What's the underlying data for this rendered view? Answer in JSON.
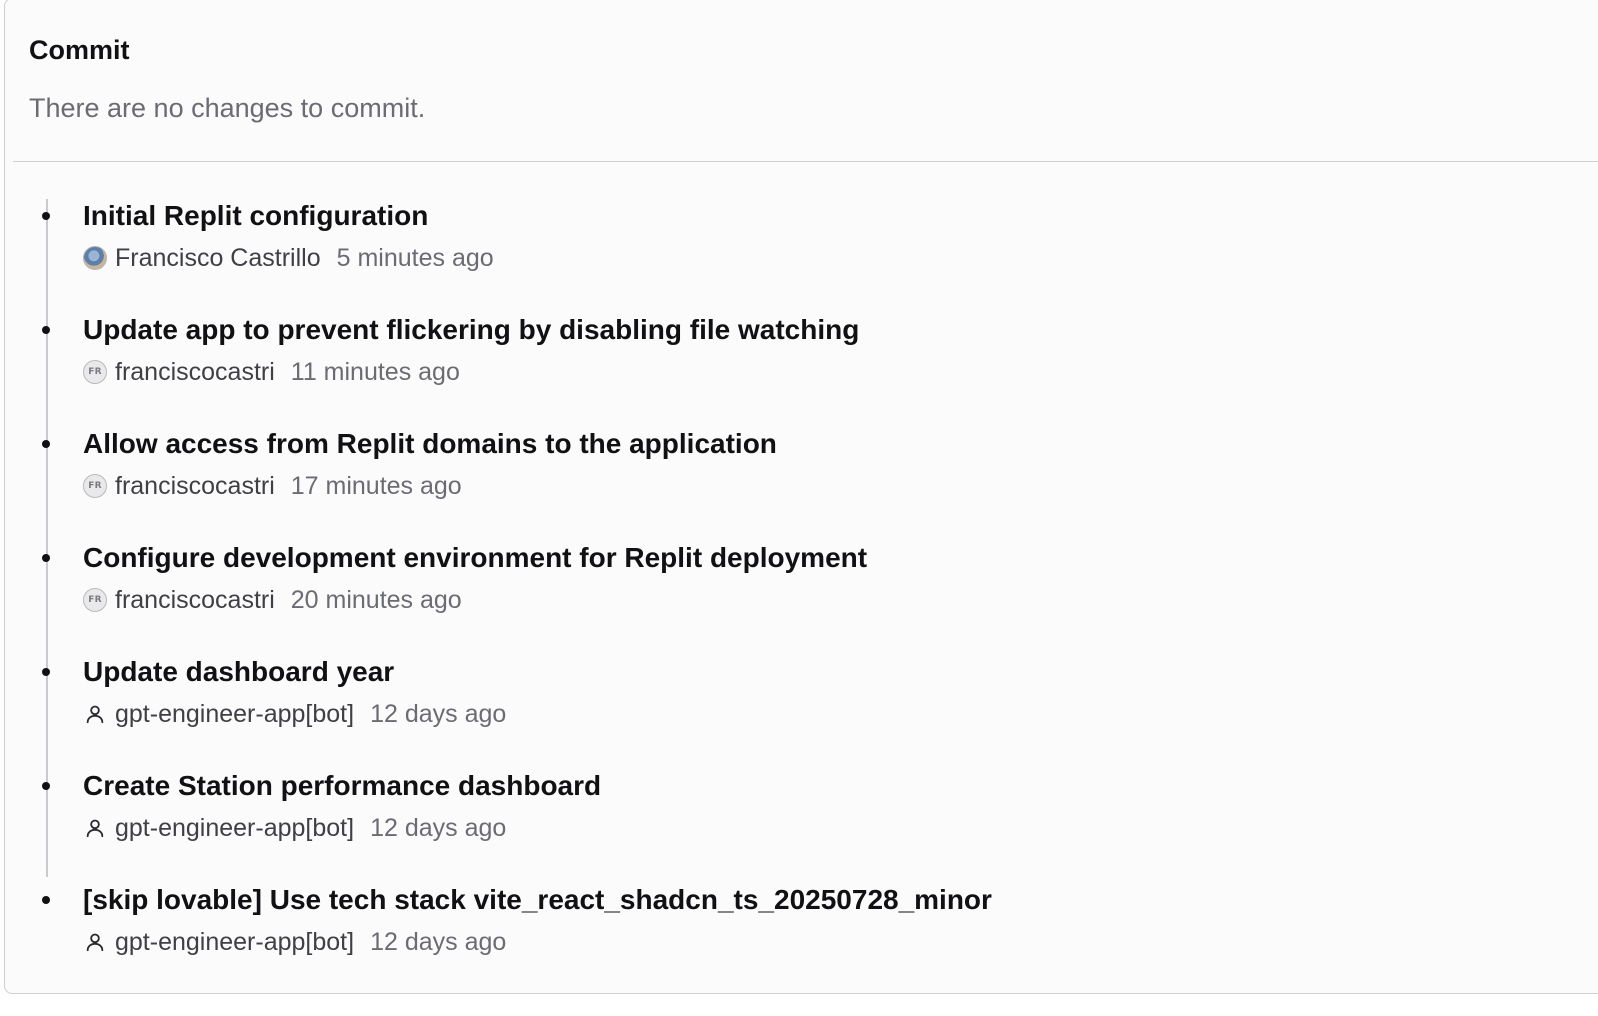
{
  "commit_panel": {
    "title": "Commit",
    "status": "There are no changes to commit."
  },
  "history": [
    {
      "message": "Initial Replit configuration",
      "author": "Francisco Castrillo",
      "time": "5 minutes ago",
      "avatar": "photo"
    },
    {
      "message": "Update app to prevent flickering by disabling file watching",
      "author": "franciscocastri",
      "time": "11 minutes ago",
      "avatar": "initials",
      "initials": "FR"
    },
    {
      "message": "Allow access from Replit domains to the application",
      "author": "franciscocastri",
      "time": "17 minutes ago",
      "avatar": "initials",
      "initials": "FR"
    },
    {
      "message": "Configure development environment for Replit deployment",
      "author": "franciscocastri",
      "time": "20 minutes ago",
      "avatar": "initials",
      "initials": "FR"
    },
    {
      "message": "Update dashboard year",
      "author": "gpt-engineer-app[bot]",
      "time": "12 days ago",
      "avatar": "person-icon"
    },
    {
      "message": "Create Station performance dashboard",
      "author": "gpt-engineer-app[bot]",
      "time": "12 days ago",
      "avatar": "person-icon"
    },
    {
      "message": "[skip lovable] Use tech stack vite_react_shadcn_ts_20250728_minor",
      "author": "gpt-engineer-app[bot]",
      "time": "12 days ago",
      "avatar": "person-icon"
    }
  ]
}
